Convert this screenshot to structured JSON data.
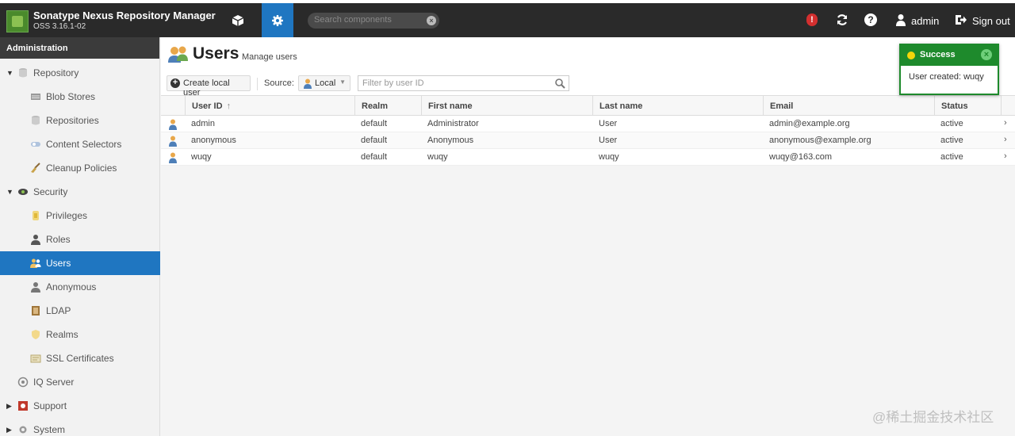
{
  "app": {
    "title": "Sonatype Nexus Repository Manager",
    "version": "OSS 3.16.1-02"
  },
  "header": {
    "search_placeholder": "Search components",
    "user_name": "admin",
    "signout_label": "Sign out",
    "alert_glyph": "!",
    "help_glyph": "?"
  },
  "sidebar": {
    "title": "Administration",
    "items": [
      {
        "label": "Repository",
        "icon": "database-icon",
        "level": 0,
        "expanded": true
      },
      {
        "label": "Blob Stores",
        "icon": "blob-store-icon",
        "level": 1
      },
      {
        "label": "Repositories",
        "icon": "database-icon",
        "level": 1
      },
      {
        "label": "Content Selectors",
        "icon": "content-selector-icon",
        "level": 1
      },
      {
        "label": "Cleanup Policies",
        "icon": "broom-icon",
        "level": 1
      },
      {
        "label": "Security",
        "icon": "eye-icon",
        "level": 0,
        "expanded": true
      },
      {
        "label": "Privileges",
        "icon": "medal-icon",
        "level": 1
      },
      {
        "label": "Roles",
        "icon": "user-tie-icon",
        "level": 1
      },
      {
        "label": "Users",
        "icon": "users-icon",
        "level": 1,
        "active": true
      },
      {
        "label": "Anonymous",
        "icon": "user-icon",
        "level": 1
      },
      {
        "label": "LDAP",
        "icon": "address-book-icon",
        "level": 1
      },
      {
        "label": "Realms",
        "icon": "shield-icon",
        "level": 1
      },
      {
        "label": "SSL Certificates",
        "icon": "certificate-icon",
        "level": 1
      },
      {
        "label": "IQ Server",
        "icon": "iq-server-icon",
        "level": 0
      },
      {
        "label": "Support",
        "icon": "support-icon",
        "level": 0,
        "expanded": false
      },
      {
        "label": "System",
        "icon": "gear-icon",
        "level": 0,
        "expanded": false
      }
    ]
  },
  "page": {
    "title": "Users",
    "subtitle": "Manage users"
  },
  "toolbar": {
    "create_label": "Create local user",
    "source_label": "Source:",
    "source_value": "Local",
    "filter_placeholder": "Filter by user ID"
  },
  "table": {
    "columns": [
      "User ID",
      "Realm",
      "First name",
      "Last name",
      "Email",
      "Status"
    ],
    "sort_indicator": "↑",
    "rows": [
      {
        "user_id": "admin",
        "realm": "default",
        "first_name": "Administrator",
        "last_name": "User",
        "email": "admin@example.org",
        "status": "active"
      },
      {
        "user_id": "anonymous",
        "realm": "default",
        "first_name": "Anonymous",
        "last_name": "User",
        "email": "anonymous@example.org",
        "status": "active"
      },
      {
        "user_id": "wuqy",
        "realm": "default",
        "first_name": "wuqy",
        "last_name": "wuqy",
        "email": "wuqy@163.com",
        "status": "active"
      }
    ]
  },
  "toast": {
    "title": "Success",
    "message": "User created: wuqy"
  },
  "watermark": "@稀土掘金技术社区",
  "colors": {
    "topbar": "#2a2a2a",
    "accent": "#1f76c1",
    "success": "#1e8a2c",
    "alert": "#d32f2f"
  }
}
